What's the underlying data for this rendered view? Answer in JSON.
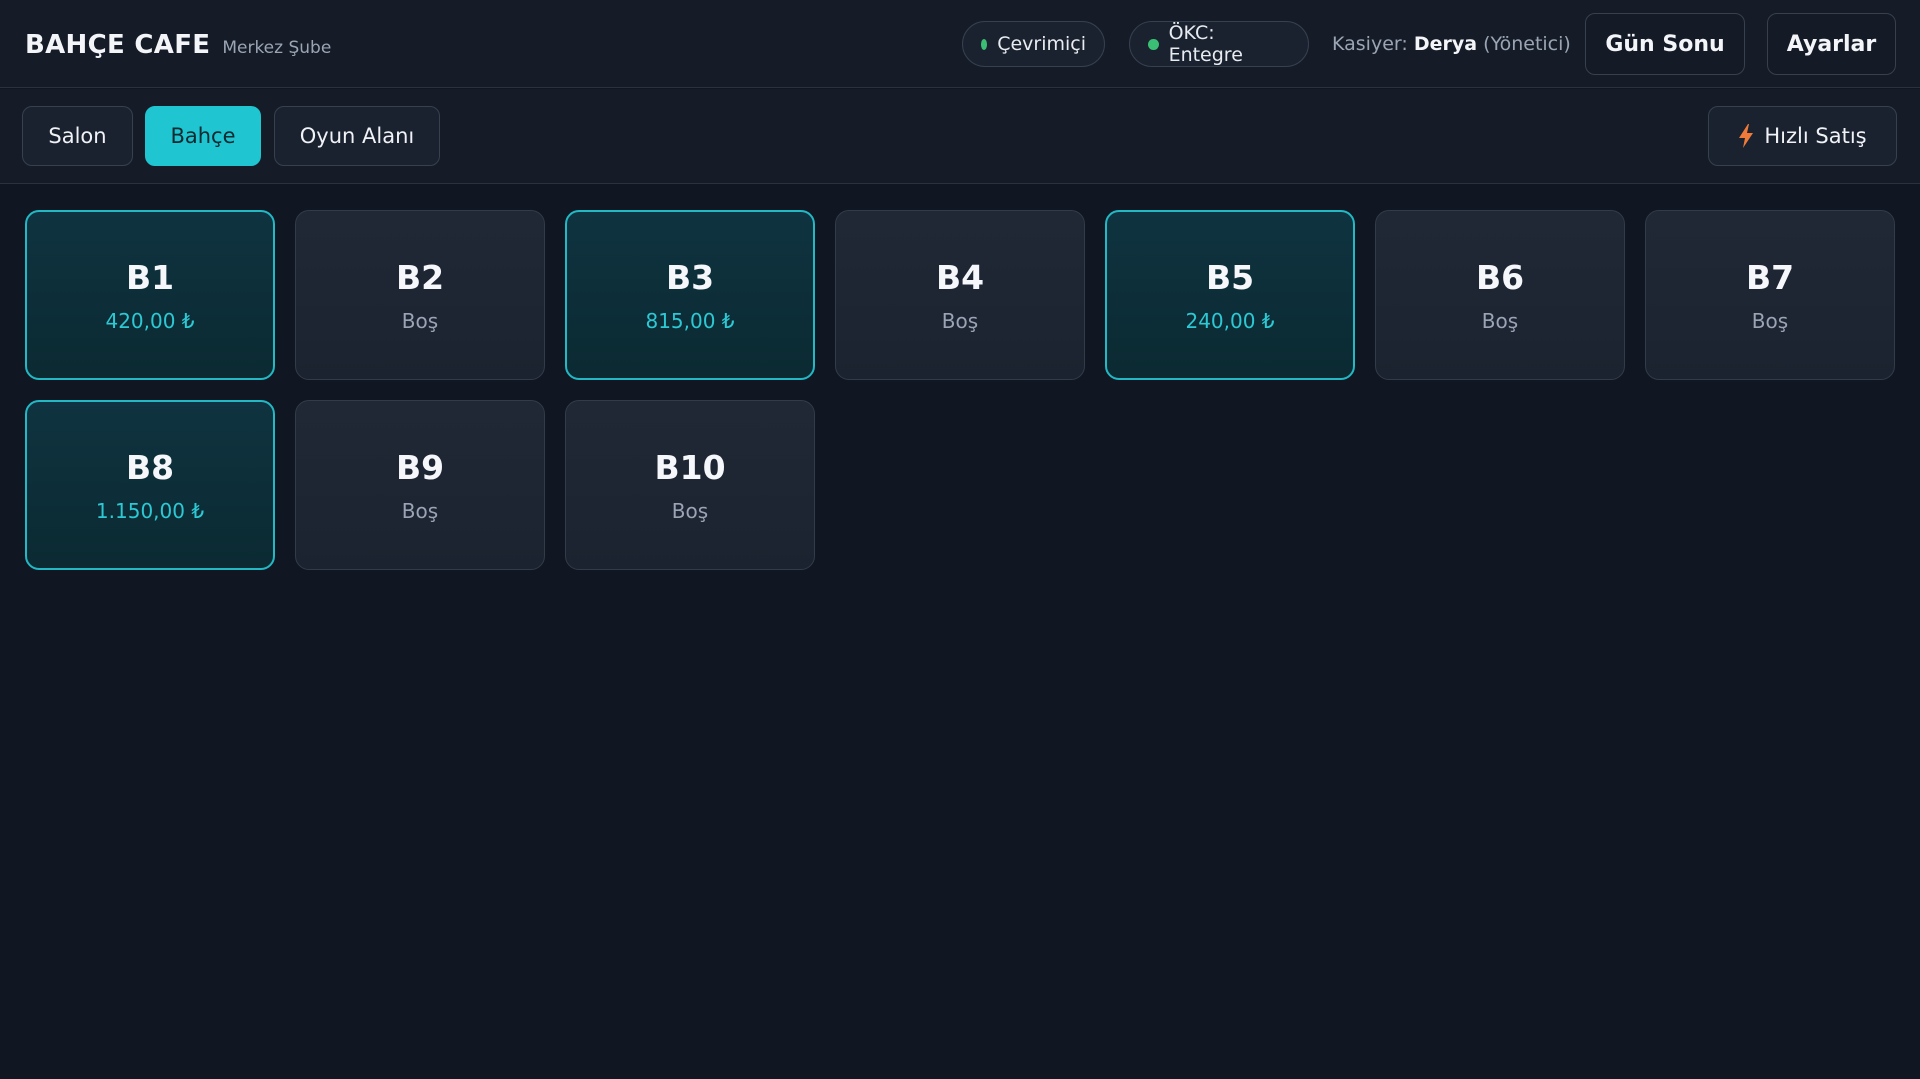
{
  "header": {
    "brand": "BAHÇE CAFE",
    "branch": "Merkez Şube",
    "status_online": "Çevrimiçi",
    "status_okc": "ÖKC: Entegre",
    "cashier_label": "Kasiyer:",
    "cashier_name": "Derya",
    "cashier_role": "(Yönetici)",
    "end_of_day": "Gün Sonu",
    "settings": "Ayarlar"
  },
  "areas": {
    "tabs": [
      {
        "label": "Salon",
        "active": false
      },
      {
        "label": "Bahçe",
        "active": true
      },
      {
        "label": "Oyun Alanı",
        "active": false
      }
    ],
    "quick_sale": "Hızlı Satış"
  },
  "tables": [
    {
      "name": "B1",
      "status": "420,00 ₺",
      "occupied": true
    },
    {
      "name": "B2",
      "status": "Boş",
      "occupied": false
    },
    {
      "name": "B3",
      "status": "815,00 ₺",
      "occupied": true
    },
    {
      "name": "B4",
      "status": "Boş",
      "occupied": false
    },
    {
      "name": "B5",
      "status": "240,00 ₺",
      "occupied": true
    },
    {
      "name": "B6",
      "status": "Boş",
      "occupied": false
    },
    {
      "name": "B7",
      "status": "Boş",
      "occupied": false
    },
    {
      "name": "B8",
      "status": "1.150,00 ₺",
      "occupied": true
    },
    {
      "name": "B9",
      "status": "Boş",
      "occupied": false
    },
    {
      "name": "B10",
      "status": "Boş",
      "occupied": false
    }
  ],
  "colors": {
    "accent": "#1fc5d1",
    "status_ok": "#3bbf74",
    "quick_icon": "#f07a3a"
  },
  "icons": {
    "status_dot": "status-dot-icon",
    "quick_sale": "lightning-icon"
  }
}
